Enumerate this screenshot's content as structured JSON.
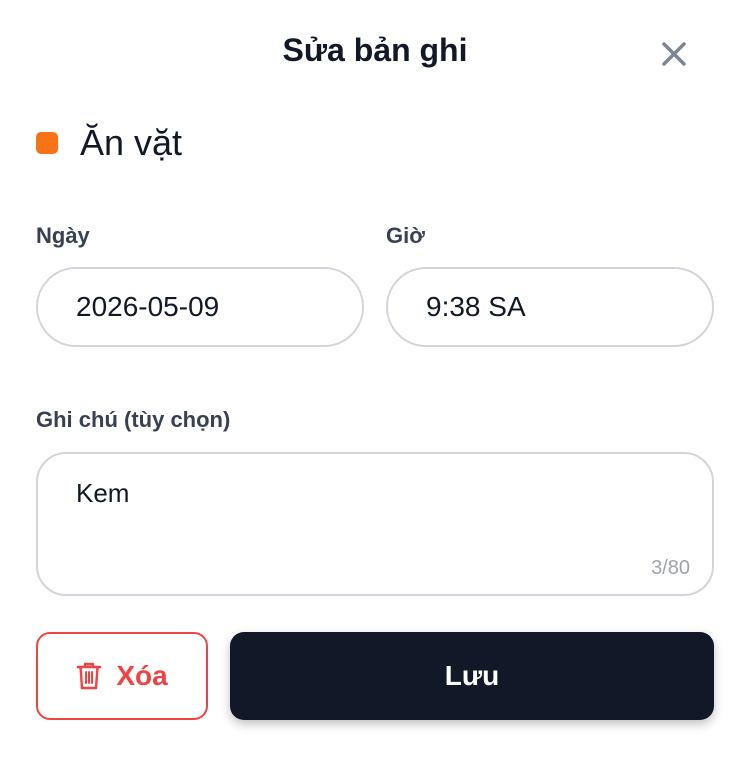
{
  "header": {
    "title": "Sửa bản ghi",
    "close_icon": "close-icon"
  },
  "category": {
    "name": "Ăn vặt",
    "color": "#f97316"
  },
  "form": {
    "date_label": "Ngày",
    "date_value": "2026-05-09",
    "time_label": "Giờ",
    "time_value": "9:38 SA",
    "note_label": "Ghi chú (tùy chọn)",
    "note_value": "Kem",
    "note_counter": "3/80"
  },
  "actions": {
    "delete_label": "Xóa",
    "delete_icon": "trash-icon",
    "save_label": "Lưu"
  },
  "colors": {
    "danger": "#ef4444",
    "primary_dark": "#111827",
    "border": "#d1d5db"
  }
}
